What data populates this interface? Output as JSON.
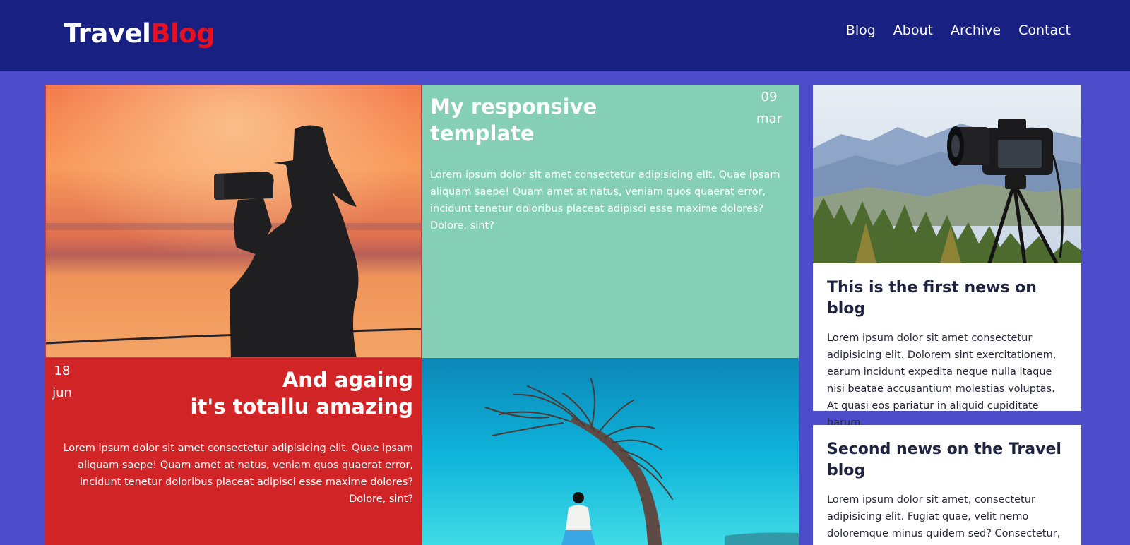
{
  "header": {
    "logo_part1": "Travel",
    "logo_part2": "Blog",
    "nav": [
      "Blog",
      "About",
      "Archive",
      "Contact"
    ]
  },
  "posts": [
    {
      "title_line1": "My responsive",
      "title_line2": "template",
      "date_day": "09",
      "date_month": "mar",
      "text": "Lorem ipsum dolor sit amet consectetur adipisicing elit. Quae ipsam aliquam saepe! Quam amet at natus, veniam quos quaerat error, incidunt tenetur doloribus placeat adipisci esse maxime dolores? Dolore, sint?"
    },
    {
      "title_line1": "And againg",
      "title_line2": "it's totallu amazing",
      "date_day": "18",
      "date_month": "jun",
      "text": "Lorem ipsum dolor sit amet consectetur adipisicing elit. Quae ipsam aliquam saepe! Quam amet at natus, veniam quos quaerat error, incidunt tenetur doloribus placeat adipisci esse maxime dolores? Dolore, sint?"
    }
  ],
  "sidebar": [
    {
      "title": "This is the first news on blog",
      "text": "Lorem ipsum dolor sit amet consectetur adipisicing elit. Dolorem sint exercitationem, earum incidunt expedita neque nulla itaque nisi beatae accusantium molestias voluptas. At quasi eos pariatur in aliquid cupiditate harum."
    },
    {
      "title": "Second news on the Travel blog",
      "text": "Lorem ipsum dolor sit amet, consectetur adipisicing elit. Fugiat quae, velit nemo doloremque minus quidem sed? Consectetur,"
    }
  ],
  "colors": {
    "header_bg": "#182081",
    "page_bg": "#4c4bc9",
    "logo_accent": "#e8101e",
    "teal_tile": "#84cfb5",
    "red_tile": "#d12427"
  }
}
